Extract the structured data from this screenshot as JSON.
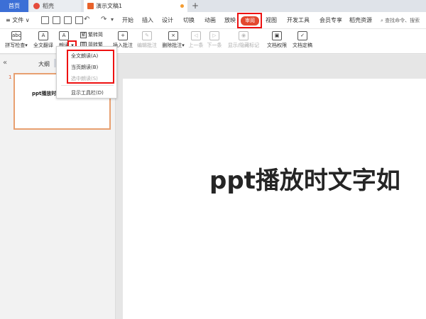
{
  "tabs": {
    "home": "首页",
    "daoke": "稻壳",
    "document": "演示文稿1",
    "new_tab": "+"
  },
  "menubar": {
    "file": "≡ 文件 ∨",
    "items": [
      "开始",
      "插入",
      "设计",
      "切换",
      "动画",
      "放映",
      "审阅",
      "视图",
      "开发工具",
      "会员专享",
      "稻壳资源"
    ],
    "active": "审阅",
    "search": "查找命令、搜索"
  },
  "ribbon": {
    "spellcheck": "拼写检查",
    "translate": "全文翻译",
    "read_aloud": "朗读",
    "trad": "繁转简",
    "simp": "简转繁",
    "insert_comment": "插入批注",
    "edit_comment": "编辑批注",
    "delete_comment": "删除批注",
    "prev": "上一条",
    "next": "下一条",
    "show_hide": "显示/隐藏标记",
    "permission": "文档权限",
    "finalize": "文档定稿"
  },
  "dropdown": {
    "items": [
      "全文朗读(A)",
      "当页朗读(B)",
      "选中朗读(S)"
    ],
    "toolbar": "显示工具栏(D)"
  },
  "leftpanel": {
    "outline_tab": "大纲",
    "slide_number": "1",
    "thumb_title": "ppt播放时文"
  },
  "slide": {
    "title": "ppt播放时文字如"
  },
  "colors": {
    "accent_blue": "#3c6fd6",
    "active_tab": "#e3482f",
    "highlight": "#ee1111"
  }
}
